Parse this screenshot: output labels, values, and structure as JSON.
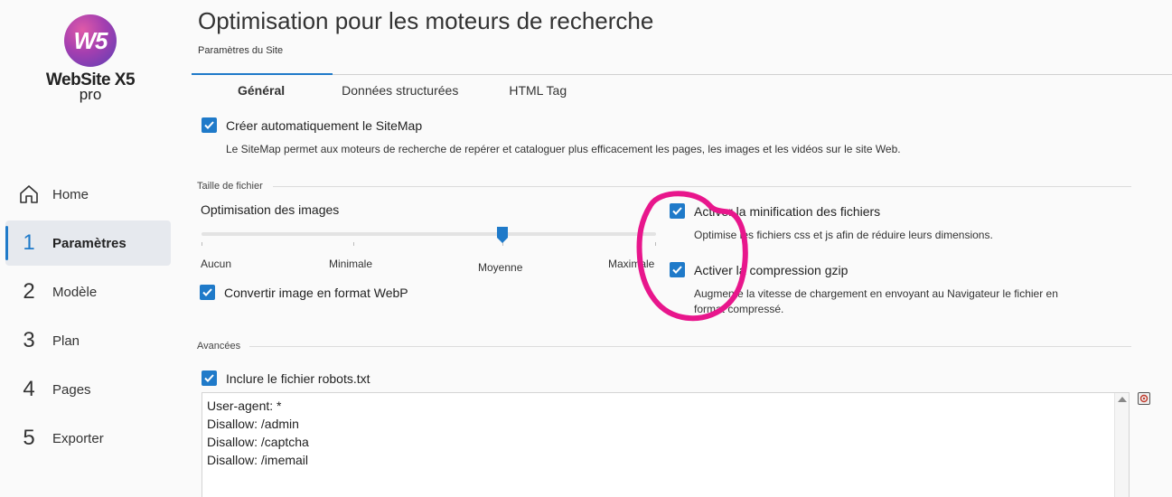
{
  "sidebar": {
    "logo_mark": "W5",
    "logo_name": "WebSite X5",
    "logo_edition": "pro",
    "items": [
      {
        "num": "",
        "icon": "home-icon",
        "label": "Home"
      },
      {
        "num": "1",
        "label": "Paramètres",
        "active": true
      },
      {
        "num": "2",
        "label": "Modèle"
      },
      {
        "num": "3",
        "label": "Plan"
      },
      {
        "num": "4",
        "label": "Pages"
      },
      {
        "num": "5",
        "label": "Exporter"
      }
    ]
  },
  "header": {
    "title": "Optimisation pour les moteurs de recherche",
    "subtitle": "Paramètres du Site"
  },
  "tabs": [
    {
      "label": "Général",
      "active": true
    },
    {
      "label": "Données structurées"
    },
    {
      "label": "HTML Tag"
    }
  ],
  "sitemap": {
    "checked": true,
    "label": "Créer automatiquement le SiteMap",
    "description": "Le SiteMap permet aux moteurs de recherche de repérer et cataloguer plus efficacement les pages, les images et les vidéos sur le site Web."
  },
  "file_size": {
    "section_label": "Taille de fichier",
    "image_optimization": {
      "label": "Optimisation des images",
      "levels": [
        "Aucun",
        "Minimale",
        "Moyenne",
        "Maximale"
      ],
      "selected_index": 2
    },
    "webp": {
      "checked": true,
      "label": "Convertir image en format WebP"
    },
    "minify": {
      "checked": true,
      "label": "Activer la minification des fichiers",
      "description": "Optimise les fichiers css et js afin de réduire leurs dimensions."
    },
    "gzip": {
      "checked": true,
      "label": "Activer la compression gzip",
      "description_line1": "Augmente la vitesse de chargement en envoyant au Navigateur le fichier en",
      "description_line2": "format compressé."
    }
  },
  "advanced": {
    "section_label": "Avancées",
    "robots": {
      "checked": true,
      "label": "Inclure le fichier robots.txt",
      "lines": [
        "User-agent: *",
        "Disallow: /admin",
        "Disallow: /captcha",
        "Disallow: /imemail"
      ]
    }
  },
  "colors": {
    "accent": "#1f7ac9",
    "annotation": "#e8168c"
  }
}
